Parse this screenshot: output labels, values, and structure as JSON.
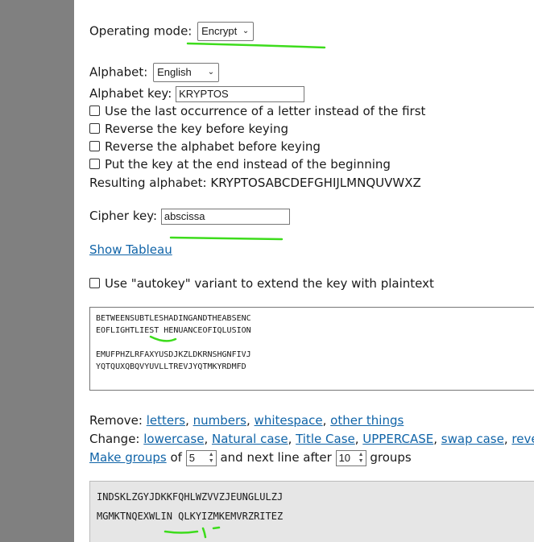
{
  "operating_mode": {
    "label": "Operating mode:",
    "selected": "Encrypt"
  },
  "alphabet": {
    "label": "Alphabet:",
    "selected": "English"
  },
  "alphabet_key": {
    "label": "Alphabet key:",
    "value": "KRYPTOS"
  },
  "options": [
    {
      "label": "Use the last occurrence of a letter instead of the first",
      "checked": false
    },
    {
      "label": "Reverse the key before keying",
      "checked": false
    },
    {
      "label": "Reverse the alphabet before keying",
      "checked": false
    },
    {
      "label": "Put the key at the end instead of the beginning",
      "checked": false
    }
  ],
  "resulting_alphabet": {
    "label": "Resulting alphabet:",
    "value": "KRYPTOSABCDEFGHIJLMNQUVWXZ"
  },
  "cipher_key": {
    "label": "Cipher key:",
    "value": "abscissa"
  },
  "show_tableau": "Show Tableau",
  "autokey": {
    "label": "Use \"autokey\" variant to extend the key with plaintext",
    "checked": false
  },
  "input_text": "BETWEENSUBTLESHADINGANDTHEABSENC\nEOFLIGHTLIEST HENUANCEOFIQLUSION\n\nEMUFPHZLRFAXYUSDJKZLDKRNSHGNFIVJ\nYQTQUXQBQVYUVLLTREVJYQTMKYRDMFD",
  "remove": {
    "label": "Remove:",
    "links": [
      "letters",
      "numbers",
      "whitespace",
      "other things"
    ]
  },
  "change": {
    "label": "Change:",
    "links": [
      "lowercase",
      "Natural case",
      "Title Case",
      "UPPERCASE",
      "swap case",
      "reverse"
    ]
  },
  "groups": {
    "link": "Make groups",
    "of": "of",
    "group_size": "5",
    "next_line": "and next line after",
    "line_groups": "10",
    "suffix": "groups"
  },
  "output_text": "INDSKLZGYJDKKFQHLWZVVZJEUNGLULZJ\nMGMKTNQEXWLIN QLKYIZMKEMVRZRITEZ",
  "colors": {
    "link": "#1064a8",
    "annotation": "#3ddc1c",
    "gutter": "#808080",
    "output_bg": "#e6e6e6"
  }
}
